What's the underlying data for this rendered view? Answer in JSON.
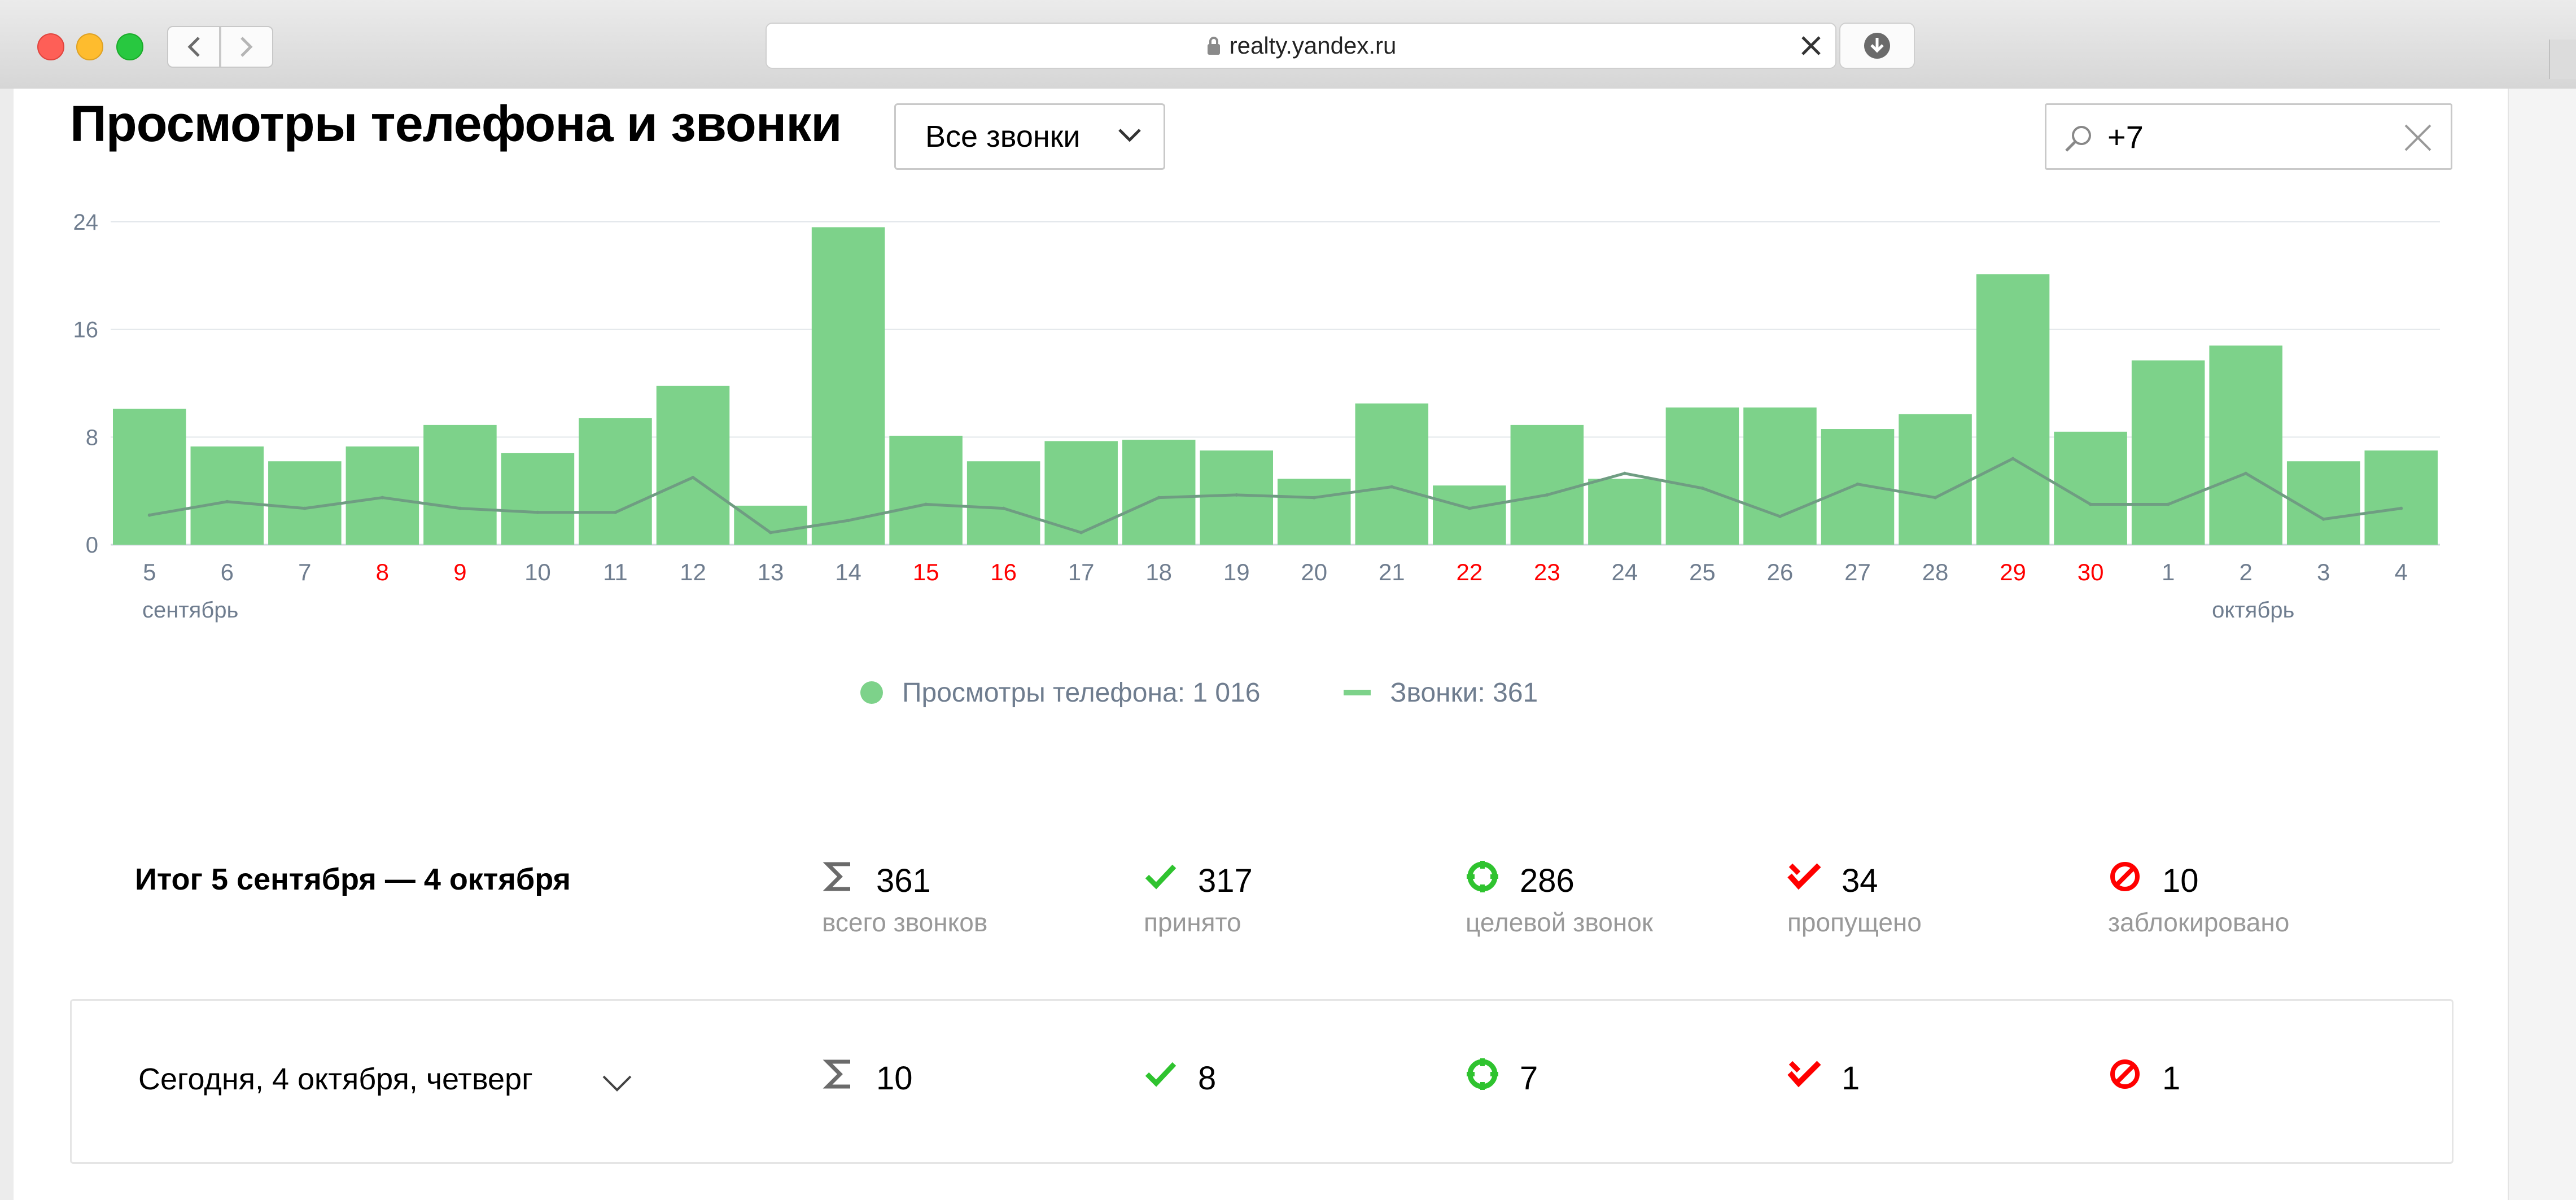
{
  "browser": {
    "url": "realty.yandex.ru"
  },
  "header": {
    "title": "Просмотры телефона и звонки",
    "filter_value": "Все звонки",
    "search_value": "+7"
  },
  "chart_data": {
    "type": "bar",
    "categories": [
      "5",
      "6",
      "7",
      "8",
      "9",
      "10",
      "11",
      "12",
      "13",
      "14",
      "15",
      "16",
      "17",
      "18",
      "19",
      "20",
      "21",
      "22",
      "23",
      "24",
      "25",
      "26",
      "27",
      "28",
      "29",
      "30",
      "1",
      "2",
      "3",
      "4"
    ],
    "weekend_days": [
      "8",
      "9",
      "15",
      "16",
      "22",
      "23",
      "29",
      "30"
    ],
    "month_labels": [
      {
        "label": "сентябрь",
        "at_category": "5"
      },
      {
        "label": "октябрь",
        "at_category": "2"
      }
    ],
    "ylim": [
      0,
      24
    ],
    "yticks": [
      "0",
      "8",
      "16",
      "24"
    ],
    "series": [
      {
        "name": "Просмотры телефона",
        "kind": "bar",
        "values": [
          10.1,
          7.3,
          6.2,
          7.3,
          8.9,
          6.8,
          9.4,
          11.8,
          2.9,
          23.6,
          8.1,
          6.2,
          7.7,
          7.8,
          7.0,
          4.9,
          10.5,
          4.4,
          8.9,
          4.9,
          10.2,
          10.2,
          8.6,
          9.7,
          20.1,
          8.4,
          13.7,
          14.8,
          6.2,
          7.0
        ]
      },
      {
        "name": "Звонки",
        "kind": "line",
        "values": [
          2.2,
          3.2,
          2.7,
          3.5,
          2.7,
          2.4,
          2.4,
          5.0,
          0.9,
          1.8,
          3.0,
          2.7,
          0.9,
          3.5,
          3.7,
          3.5,
          4.3,
          2.7,
          3.7,
          5.3,
          4.2,
          2.1,
          4.5,
          3.5,
          6.4,
          3.0,
          3.0,
          5.3,
          1.9,
          2.7
        ]
      }
    ],
    "bar_color": "#7dd28a",
    "line_color": "#6f9d82",
    "weekday_label_color": "#6f7d8f",
    "weekend_label_color": "#ff0000"
  },
  "legend": {
    "views": "Просмотры телефона: 1 016",
    "calls": "Звонки: 361"
  },
  "summary": {
    "title": "Итог 5 сентября — 4 октября",
    "stats": [
      {
        "icon": "sigma-icon",
        "value": "361",
        "caption": "всего звонков"
      },
      {
        "icon": "check-icon",
        "value": "317",
        "caption": "принято"
      },
      {
        "icon": "target-icon",
        "value": "286",
        "caption": "целевой звонок"
      },
      {
        "icon": "missed-call-icon",
        "value": "34",
        "caption": "пропущено"
      },
      {
        "icon": "blocked-icon",
        "value": "10",
        "caption": "заблокировано"
      }
    ]
  },
  "today": {
    "title": "Сегодня, 4 октября, четверг",
    "stats": [
      {
        "icon": "sigma-icon",
        "value": "10"
      },
      {
        "icon": "check-icon",
        "value": "8"
      },
      {
        "icon": "target-icon",
        "value": "7"
      },
      {
        "icon": "missed-call-icon",
        "value": "1"
      },
      {
        "icon": "blocked-icon",
        "value": "1"
      }
    ]
  },
  "colors": {
    "accept_green": "#2fc32f",
    "missed_red": "#ff0000",
    "sigma_gray": "#6b6b6b"
  }
}
